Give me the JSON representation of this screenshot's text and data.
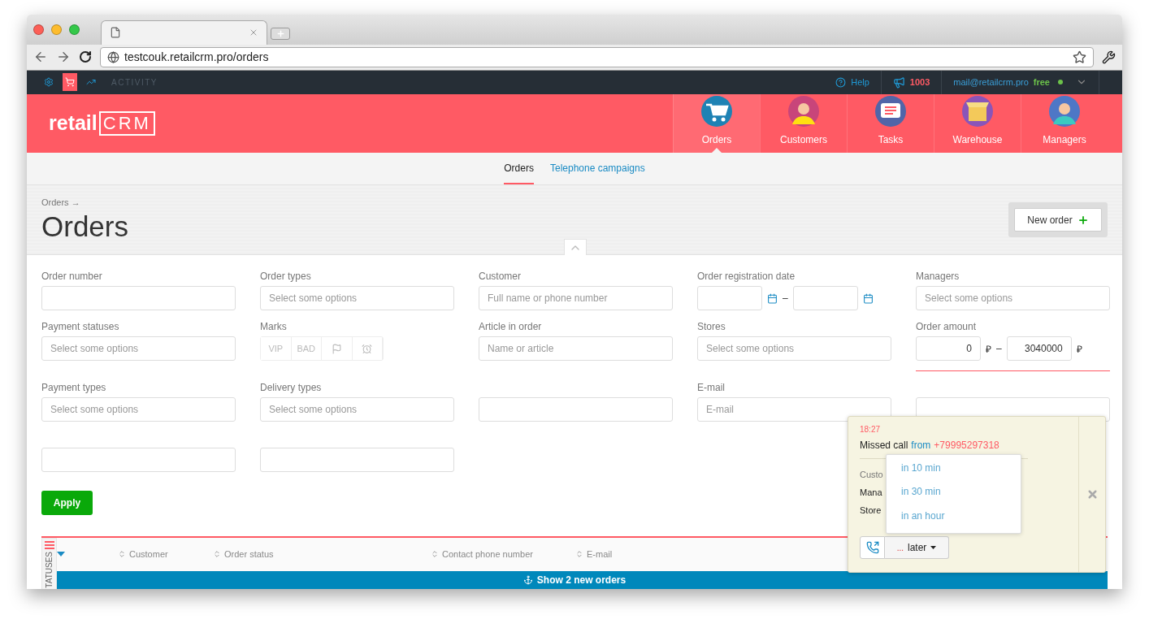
{
  "browser": {
    "url": "testcouk.retailcrm.pro/orders"
  },
  "topbar": {
    "icons": [
      {
        "kind": "settings",
        "selected": false
      },
      {
        "kind": "cart",
        "selected": true
      },
      {
        "kind": "chart",
        "selected": false
      }
    ],
    "activity": "ACTIVITY",
    "help": "Help",
    "notifications": "1003",
    "email": "mail@retailcrm.pro",
    "plan": "free"
  },
  "header": {
    "logo": {
      "word": "retail",
      "mark": "CRM"
    },
    "nav": [
      {
        "label": "Orders",
        "kind": "orders",
        "selected": true
      },
      {
        "label": "Customers",
        "kind": "customers",
        "selected": false
      },
      {
        "label": "Tasks",
        "kind": "tasks",
        "selected": false
      },
      {
        "label": "Warehouse",
        "kind": "warehouse",
        "selected": false
      },
      {
        "label": "Managers",
        "kind": "managers",
        "selected": false
      }
    ]
  },
  "subnav": [
    {
      "label": "Orders",
      "selected": true
    },
    {
      "label": "Telephone campaigns",
      "selected": false
    }
  ],
  "breadcrumb": "Orders →",
  "title": "Orders",
  "new_order_button": "New order",
  "filters": [
    {
      "kind": "text",
      "label": "Order number"
    },
    {
      "kind": "text",
      "label": "Order types",
      "placeholder": "Select some options"
    },
    {
      "kind": "text",
      "label": "Customer",
      "placeholder": "Full name or phone number"
    },
    {
      "kind": "date_range",
      "label": "Order registration date",
      "separator": "–"
    },
    {
      "kind": "text",
      "label": "Managers",
      "placeholder": "Select some options"
    },
    {
      "kind": "text",
      "label": "Payment statuses",
      "placeholder": "Select some options"
    },
    {
      "kind": "marks",
      "label": "Marks",
      "marks": [
        {
          "kind": "text",
          "label": "VIP"
        },
        {
          "kind": "text",
          "label": "BAD"
        },
        {
          "kind": "flag"
        },
        {
          "kind": "clock"
        }
      ]
    },
    {
      "kind": "text",
      "label": "Article in order",
      "placeholder": "Name or article"
    },
    {
      "kind": "text",
      "label": "Stores",
      "placeholder": "Select some options"
    },
    {
      "kind": "amount_range",
      "label": "Order amount",
      "from": "0",
      "to": "3040000",
      "currency": "₽",
      "separator": "–"
    },
    {
      "kind": "text",
      "label": "Payment types",
      "placeholder": "Select some options"
    },
    {
      "kind": "text",
      "label": "Delivery types",
      "placeholder": "Select some options"
    },
    {
      "kind": "text"
    },
    {
      "kind": "text",
      "label": "E-mail",
      "placeholder": "E-mail"
    },
    {
      "kind": "text"
    },
    {
      "kind": "text"
    },
    {
      "kind": "text"
    }
  ],
  "apply_button": "Apply",
  "table": {
    "statuses_tab": "TATUSES",
    "columns": [
      "Customer",
      "Order status",
      "Contact phone number",
      "E-mail"
    ],
    "new_orders_bar": "Show 2 new orders"
  },
  "notification": {
    "time": "18:27",
    "message": "Missed call",
    "from": "from",
    "phone": "+79995297318",
    "fields": [
      "Custo",
      "Mana",
      "Store"
    ],
    "later_dots": "...",
    "later_button": "later",
    "options": [
      "in 10 min",
      "in 30 min",
      "in an hour"
    ]
  }
}
